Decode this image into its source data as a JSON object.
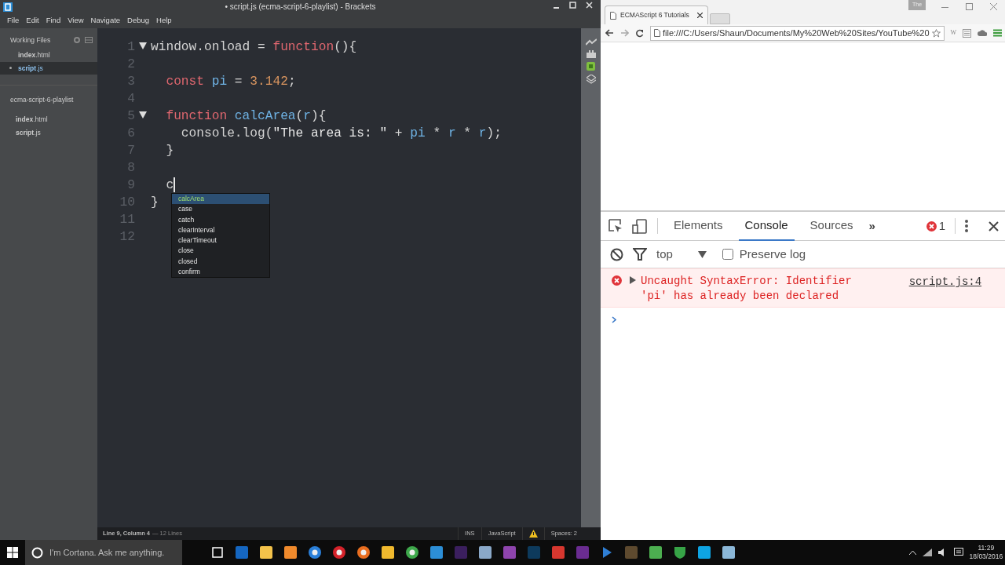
{
  "editor": {
    "title": "• script.js (ecma-script-6-playlist) - Brackets",
    "menu": [
      "File",
      "Edit",
      "Find",
      "View",
      "Navigate",
      "Debug",
      "Help"
    ],
    "working_files_title": "Working Files",
    "working_files": [
      {
        "name": "index",
        "ext": ".html",
        "selected": false,
        "modified": false
      },
      {
        "name": "script",
        "ext": ".js",
        "selected": true,
        "modified": true
      }
    ],
    "project_title": "ecma-script-6-playlist",
    "project_files": [
      {
        "name": "index",
        "ext": ".html"
      },
      {
        "name": "script",
        "ext": ".js"
      }
    ],
    "code_lines": [
      {
        "number": "1",
        "foldable": true,
        "cursor": false,
        "tokens": [
          {
            "kind": "plain",
            "text": "window.onload = "
          },
          {
            "kind": "keyword",
            "text": "function"
          },
          {
            "kind": "plain",
            "text": "(){"
          }
        ]
      },
      {
        "number": "2",
        "foldable": false,
        "cursor": false
      },
      {
        "number": "3",
        "foldable": false,
        "cursor": false,
        "tokens": [
          {
            "kind": "keyword",
            "text": "  const"
          },
          {
            "kind": "ident",
            "text": " pi"
          },
          {
            "kind": "plain",
            "text": " = "
          },
          {
            "kind": "number",
            "text": "3.142"
          },
          {
            "kind": "plain",
            "text": ";"
          }
        ]
      },
      {
        "number": "4",
        "foldable": false,
        "cursor": false
      },
      {
        "number": "5",
        "foldable": true,
        "cursor": false,
        "tokens": [
          {
            "kind": "keyword",
            "text": "  function"
          },
          {
            "kind": "ident",
            "text": " calcArea"
          },
          {
            "kind": "plain",
            "text": "("
          },
          {
            "kind": "ident",
            "text": "r"
          },
          {
            "kind": "plain",
            "text": "){"
          }
        ]
      },
      {
        "number": "6",
        "foldable": false,
        "cursor": false,
        "tokens": [
          {
            "kind": "plain",
            "text": "    console.log("
          },
          {
            "kind": "string",
            "text": "\"The area is: \""
          },
          {
            "kind": "plain",
            "text": " + "
          },
          {
            "kind": "ident",
            "text": "pi"
          },
          {
            "kind": "plain",
            "text": " * "
          },
          {
            "kind": "ident",
            "text": "r"
          },
          {
            "kind": "plain",
            "text": " * "
          },
          {
            "kind": "ident",
            "text": "r"
          },
          {
            "kind": "plain",
            "text": ");"
          }
        ]
      },
      {
        "number": "7",
        "foldable": false,
        "cursor": false,
        "tokens": [
          {
            "kind": "plain",
            "text": "  }"
          }
        ]
      },
      {
        "number": "8",
        "foldable": false,
        "cursor": false
      },
      {
        "number": "9",
        "foldable": false,
        "cursor": true,
        "tokens": [
          {
            "kind": "plain",
            "text": "  c"
          }
        ]
      },
      {
        "number": "10",
        "foldable": false,
        "cursor": false,
        "tokens": [
          {
            "kind": "plain",
            "text": "}"
          }
        ]
      },
      {
        "number": "11",
        "foldable": false,
        "cursor": false
      },
      {
        "number": "12",
        "foldable": false,
        "cursor": false
      }
    ],
    "autocomplete": [
      {
        "text": "calcArea",
        "selected": true
      },
      {
        "text": "case",
        "selected": false
      },
      {
        "text": "catch",
        "selected": false
      },
      {
        "text": "clearInterval",
        "selected": false
      },
      {
        "text": "clearTimeout",
        "selected": false
      },
      {
        "text": "close",
        "selected": false
      },
      {
        "text": "closed",
        "selected": false
      },
      {
        "text": "confirm",
        "selected": false
      }
    ],
    "status_bar": {
      "position": "Line 9, Column 4",
      "line_count": "— 12 Lines",
      "mode": "INS",
      "language": "JavaScript",
      "indent": "Spaces: 2"
    }
  },
  "browser": {
    "tab_title": "ECMAScript 6 Tutorials",
    "profile_badge": "The",
    "address": "file:///C:/Users/Shaun/Documents/My%20Web%20Sites/YouTube%20",
    "extension_label": "W",
    "devtools": {
      "tabs": [
        {
          "label": "Elements",
          "selected": false
        },
        {
          "label": "Console",
          "selected": true
        },
        {
          "label": "Sources",
          "selected": false
        }
      ],
      "more": "»",
      "error_count": "1",
      "context": "top",
      "preserve_log": {
        "label": "Preserve log",
        "checked": false
      },
      "messages": [
        {
          "kind": "error",
          "text": "Uncaught SyntaxError: Identifier 'pi' has already been declared",
          "source": "script.js:4"
        }
      ]
    }
  },
  "taskbar": {
    "search_placeholder": "I'm Cortana. Ask me anything.",
    "time": "11:29",
    "date": "18/03/2016"
  }
}
